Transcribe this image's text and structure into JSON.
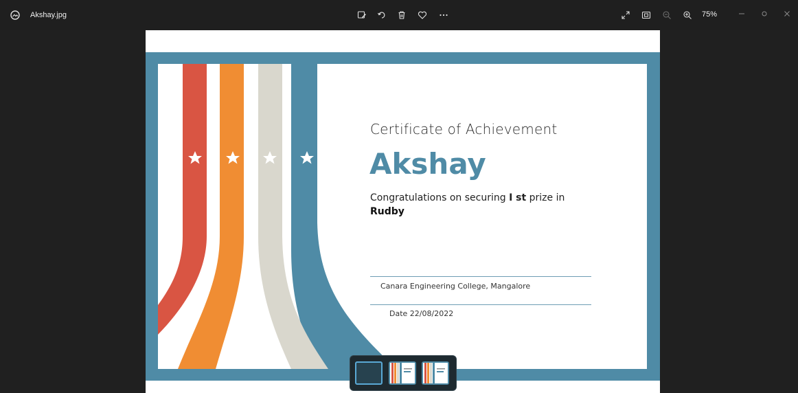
{
  "titlebar": {
    "file_name": "Akshay.jpg",
    "zoom_label": "75%",
    "icons": [
      "photos-app-icon",
      "edit-image-icon",
      "rotate-icon",
      "delete-icon",
      "favorite-icon",
      "more-options-icon",
      "fullscreen-icon",
      "fit-to-window-icon",
      "zoom-out-icon",
      "zoom-in-icon"
    ]
  },
  "certificate": {
    "title": "Certificate of Achievement",
    "name": "Akshay",
    "line_prefix": "Congratulations on securing ",
    "line_bold": "I st",
    "line_suffix": " prize in",
    "event": "Rudby",
    "organization": "Canara Engineering College, Mangalore",
    "date": "Date 22/08/2022",
    "colors": {
      "border": "#4f8ba6",
      "stripe_red": "#d95543",
      "stripe_orange": "#f08d33",
      "stripe_gray": "#d9d7cd",
      "stripe_blue": "#4f8ba6",
      "name_color": "#4f8ba6"
    }
  },
  "filmstrip": {
    "thumbnails": 3,
    "active_index": 0
  }
}
